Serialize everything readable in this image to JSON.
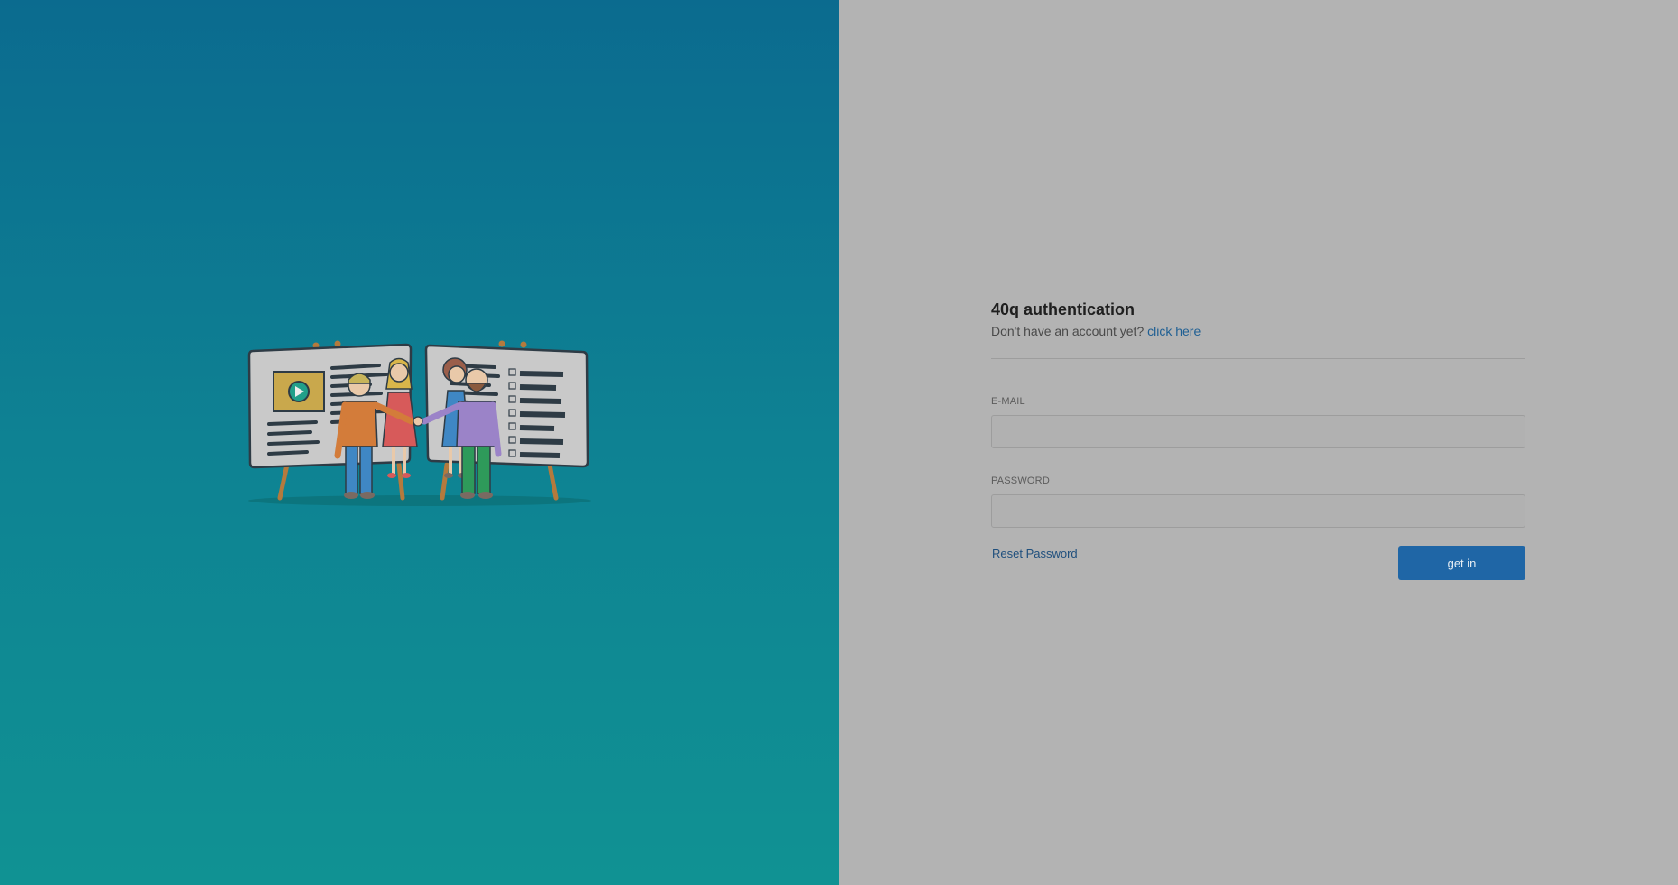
{
  "hero": {
    "illustration_icon": "team-presentation-illustration",
    "gradient_top": "#0b6b8f",
    "gradient_bottom": "#109293"
  },
  "auth": {
    "title": "40q authentication",
    "signup_prompt": "Don't have an account yet?",
    "signup_link": "click here",
    "email_label": "E-MAIL",
    "email_value": "",
    "password_label": "PASSWORD",
    "password_value": "",
    "reset_link": "Reset Password",
    "submit_label": "get in",
    "accent_color": "#1f66a6",
    "background_color": "#b3b3b3"
  }
}
